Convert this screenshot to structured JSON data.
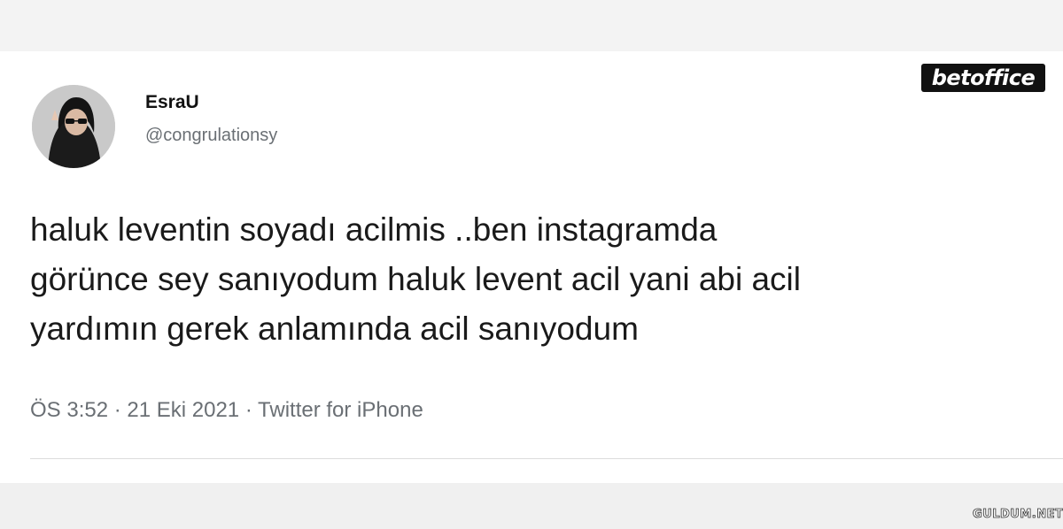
{
  "tweet": {
    "display_name": "EsraU",
    "handle": "@congrulationsy",
    "text": "haluk leventin soyadı acilmis ..ben instagramda\ngörünce sey sanıyodum haluk levent acil yani abi acil\nyardımın gerek anlamında acil sanıyodum",
    "meta": "ÖS 3:52 · 21 Eki 2021 · Twitter for iPhone"
  },
  "brand_logo": "betoffice",
  "watermark": "GULDUM.NET"
}
